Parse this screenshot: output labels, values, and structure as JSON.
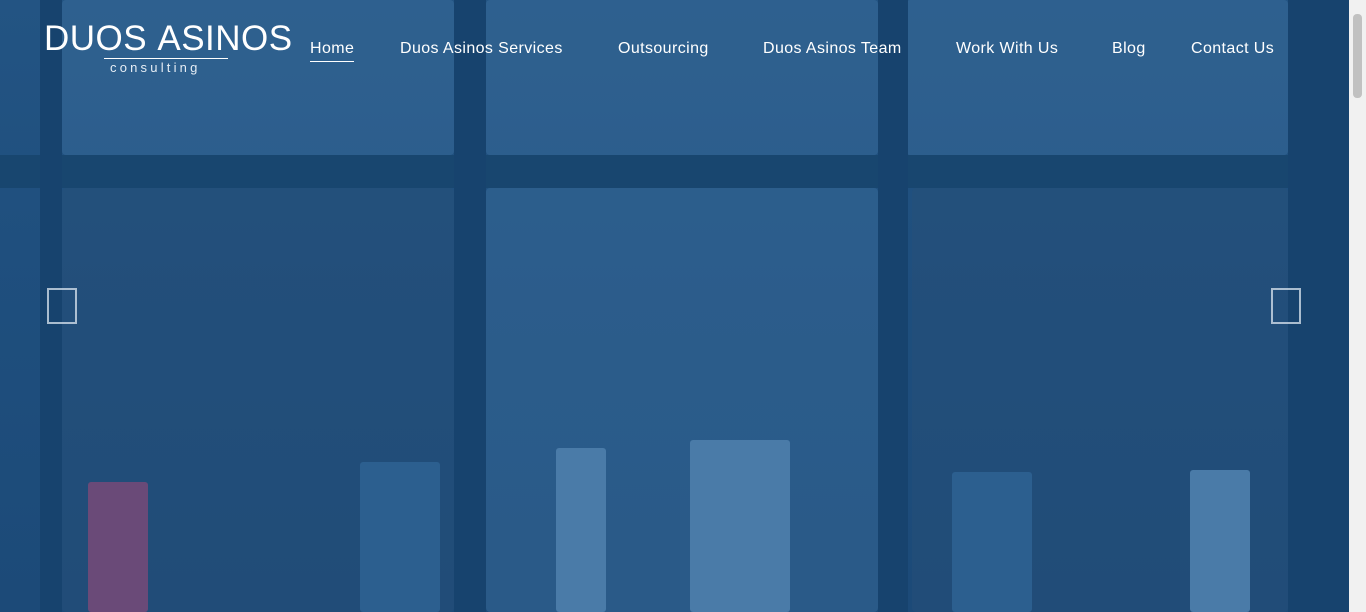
{
  "logo": {
    "main_light": "DUOS ",
    "main_bold": "ASINOS",
    "sub": "consulting"
  },
  "nav": {
    "items": [
      {
        "label": "Home"
      },
      {
        "label": "Duos Asinos Services"
      },
      {
        "label": "Outsourcing"
      },
      {
        "label": "Duos Asinos Team"
      },
      {
        "label": "Work With Us"
      },
      {
        "label": "Blog"
      },
      {
        "label": "Contact Us"
      }
    ],
    "active_index": 0
  },
  "slider": {
    "prev_icon": "chevron-left-icon",
    "next_icon": "chevron-right-icon"
  },
  "colors": {
    "overlay": "#1f4f7d",
    "text": "#ffffff",
    "scrollbar": "#f1f1f1"
  }
}
